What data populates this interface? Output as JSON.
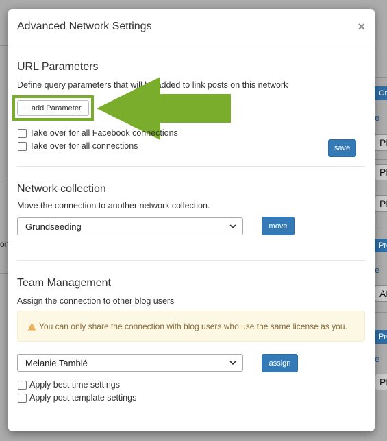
{
  "background": {
    "fragments": {
      "group_btn": "Grou",
      "profile_btn_1": "Profi",
      "profile_btn_2": "Profi",
      "link_e_1": "e",
      "link_e_2": "e",
      "link_e_3": "e",
      "time_1": "PM",
      "time_2": "PM",
      "time_3": "PM",
      "time_4": "AM",
      "time_5": "PM",
      "side_text": "om"
    }
  },
  "modal": {
    "title": "Advanced Network Settings",
    "close_glyph": "×"
  },
  "url_params": {
    "title": "URL Parameters",
    "description": "Define query parameters that will be added to link posts on this network",
    "add_button": "+ add Parameter",
    "checkbox_facebook": "Take over for all Facebook connections",
    "checkbox_all": "Take over for all connections",
    "save_button": "save"
  },
  "network_collection": {
    "title": "Network collection",
    "description": "Move the connection to another network collection.",
    "selected": "Grundseeding",
    "move_button": "move"
  },
  "team": {
    "title": "Team Management",
    "description": "Assign the connection to other blog users",
    "alert_text": "You can only share the connection with blog users who use the same license as you.",
    "selected_user": "Melanie Tamblé",
    "assign_button": "assign",
    "checkbox_best_time": "Apply best time settings",
    "checkbox_template": "Apply post template settings"
  },
  "colors": {
    "accent_green": "#7aad2c",
    "primary_blue": "#337ab7",
    "warning_bg": "#fcf8e3"
  },
  "icons": {
    "close": "close-icon",
    "arrow": "arrow-left-icon",
    "chevron": "chevron-down-icon",
    "warning": "warning-icon"
  }
}
